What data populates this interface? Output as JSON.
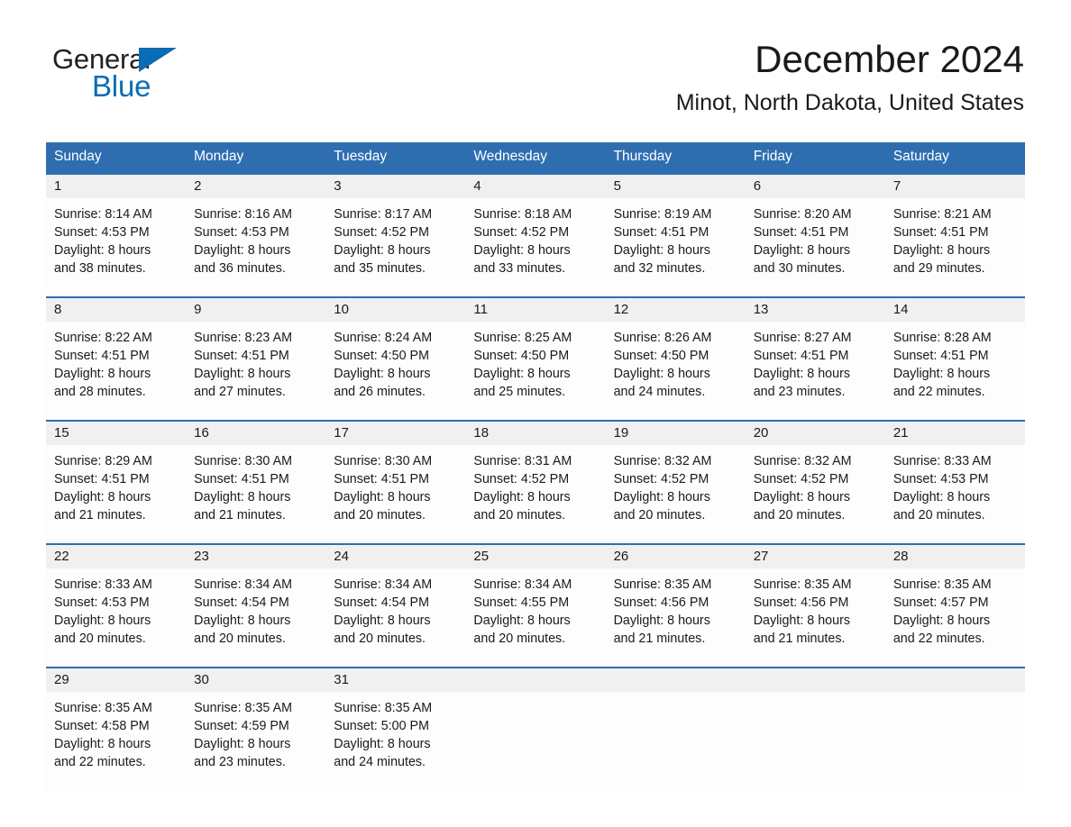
{
  "brand": {
    "name_part1": "General",
    "name_part2": "Blue",
    "accent_color": "#0a6cb4"
  },
  "header": {
    "title": "December 2024",
    "location": "Minot, North Dakota, United States"
  },
  "theme": {
    "header_blue": "#2e6eb0",
    "daynum_bg": "#f0f0f0",
    "cell_bg": "#fdfdfd",
    "text": "#1a1a1a"
  },
  "weekdays": [
    "Sunday",
    "Monday",
    "Tuesday",
    "Wednesday",
    "Thursday",
    "Friday",
    "Saturday"
  ],
  "weeks": [
    {
      "days": [
        {
          "num": "1",
          "sunrise": "Sunrise: 8:14 AM",
          "sunset": "Sunset: 4:53 PM",
          "daylight_1": "Daylight: 8 hours",
          "daylight_2": "and 38 minutes."
        },
        {
          "num": "2",
          "sunrise": "Sunrise: 8:16 AM",
          "sunset": "Sunset: 4:53 PM",
          "daylight_1": "Daylight: 8 hours",
          "daylight_2": "and 36 minutes."
        },
        {
          "num": "3",
          "sunrise": "Sunrise: 8:17 AM",
          "sunset": "Sunset: 4:52 PM",
          "daylight_1": "Daylight: 8 hours",
          "daylight_2": "and 35 minutes."
        },
        {
          "num": "4",
          "sunrise": "Sunrise: 8:18 AM",
          "sunset": "Sunset: 4:52 PM",
          "daylight_1": "Daylight: 8 hours",
          "daylight_2": "and 33 minutes."
        },
        {
          "num": "5",
          "sunrise": "Sunrise: 8:19 AM",
          "sunset": "Sunset: 4:51 PM",
          "daylight_1": "Daylight: 8 hours",
          "daylight_2": "and 32 minutes."
        },
        {
          "num": "6",
          "sunrise": "Sunrise: 8:20 AM",
          "sunset": "Sunset: 4:51 PM",
          "daylight_1": "Daylight: 8 hours",
          "daylight_2": "and 30 minutes."
        },
        {
          "num": "7",
          "sunrise": "Sunrise: 8:21 AM",
          "sunset": "Sunset: 4:51 PM",
          "daylight_1": "Daylight: 8 hours",
          "daylight_2": "and 29 minutes."
        }
      ]
    },
    {
      "days": [
        {
          "num": "8",
          "sunrise": "Sunrise: 8:22 AM",
          "sunset": "Sunset: 4:51 PM",
          "daylight_1": "Daylight: 8 hours",
          "daylight_2": "and 28 minutes."
        },
        {
          "num": "9",
          "sunrise": "Sunrise: 8:23 AM",
          "sunset": "Sunset: 4:51 PM",
          "daylight_1": "Daylight: 8 hours",
          "daylight_2": "and 27 minutes."
        },
        {
          "num": "10",
          "sunrise": "Sunrise: 8:24 AM",
          "sunset": "Sunset: 4:50 PM",
          "daylight_1": "Daylight: 8 hours",
          "daylight_2": "and 26 minutes."
        },
        {
          "num": "11",
          "sunrise": "Sunrise: 8:25 AM",
          "sunset": "Sunset: 4:50 PM",
          "daylight_1": "Daylight: 8 hours",
          "daylight_2": "and 25 minutes."
        },
        {
          "num": "12",
          "sunrise": "Sunrise: 8:26 AM",
          "sunset": "Sunset: 4:50 PM",
          "daylight_1": "Daylight: 8 hours",
          "daylight_2": "and 24 minutes."
        },
        {
          "num": "13",
          "sunrise": "Sunrise: 8:27 AM",
          "sunset": "Sunset: 4:51 PM",
          "daylight_1": "Daylight: 8 hours",
          "daylight_2": "and 23 minutes."
        },
        {
          "num": "14",
          "sunrise": "Sunrise: 8:28 AM",
          "sunset": "Sunset: 4:51 PM",
          "daylight_1": "Daylight: 8 hours",
          "daylight_2": "and 22 minutes."
        }
      ]
    },
    {
      "days": [
        {
          "num": "15",
          "sunrise": "Sunrise: 8:29 AM",
          "sunset": "Sunset: 4:51 PM",
          "daylight_1": "Daylight: 8 hours",
          "daylight_2": "and 21 minutes."
        },
        {
          "num": "16",
          "sunrise": "Sunrise: 8:30 AM",
          "sunset": "Sunset: 4:51 PM",
          "daylight_1": "Daylight: 8 hours",
          "daylight_2": "and 21 minutes."
        },
        {
          "num": "17",
          "sunrise": "Sunrise: 8:30 AM",
          "sunset": "Sunset: 4:51 PM",
          "daylight_1": "Daylight: 8 hours",
          "daylight_2": "and 20 minutes."
        },
        {
          "num": "18",
          "sunrise": "Sunrise: 8:31 AM",
          "sunset": "Sunset: 4:52 PM",
          "daylight_1": "Daylight: 8 hours",
          "daylight_2": "and 20 minutes."
        },
        {
          "num": "19",
          "sunrise": "Sunrise: 8:32 AM",
          "sunset": "Sunset: 4:52 PM",
          "daylight_1": "Daylight: 8 hours",
          "daylight_2": "and 20 minutes."
        },
        {
          "num": "20",
          "sunrise": "Sunrise: 8:32 AM",
          "sunset": "Sunset: 4:52 PM",
          "daylight_1": "Daylight: 8 hours",
          "daylight_2": "and 20 minutes."
        },
        {
          "num": "21",
          "sunrise": "Sunrise: 8:33 AM",
          "sunset": "Sunset: 4:53 PM",
          "daylight_1": "Daylight: 8 hours",
          "daylight_2": "and 20 minutes."
        }
      ]
    },
    {
      "days": [
        {
          "num": "22",
          "sunrise": "Sunrise: 8:33 AM",
          "sunset": "Sunset: 4:53 PM",
          "daylight_1": "Daylight: 8 hours",
          "daylight_2": "and 20 minutes."
        },
        {
          "num": "23",
          "sunrise": "Sunrise: 8:34 AM",
          "sunset": "Sunset: 4:54 PM",
          "daylight_1": "Daylight: 8 hours",
          "daylight_2": "and 20 minutes."
        },
        {
          "num": "24",
          "sunrise": "Sunrise: 8:34 AM",
          "sunset": "Sunset: 4:54 PM",
          "daylight_1": "Daylight: 8 hours",
          "daylight_2": "and 20 minutes."
        },
        {
          "num": "25",
          "sunrise": "Sunrise: 8:34 AM",
          "sunset": "Sunset: 4:55 PM",
          "daylight_1": "Daylight: 8 hours",
          "daylight_2": "and 20 minutes."
        },
        {
          "num": "26",
          "sunrise": "Sunrise: 8:35 AM",
          "sunset": "Sunset: 4:56 PM",
          "daylight_1": "Daylight: 8 hours",
          "daylight_2": "and 21 minutes."
        },
        {
          "num": "27",
          "sunrise": "Sunrise: 8:35 AM",
          "sunset": "Sunset: 4:56 PM",
          "daylight_1": "Daylight: 8 hours",
          "daylight_2": "and 21 minutes."
        },
        {
          "num": "28",
          "sunrise": "Sunrise: 8:35 AM",
          "sunset": "Sunset: 4:57 PM",
          "daylight_1": "Daylight: 8 hours",
          "daylight_2": "and 22 minutes."
        }
      ]
    },
    {
      "days": [
        {
          "num": "29",
          "sunrise": "Sunrise: 8:35 AM",
          "sunset": "Sunset: 4:58 PM",
          "daylight_1": "Daylight: 8 hours",
          "daylight_2": "and 22 minutes."
        },
        {
          "num": "30",
          "sunrise": "Sunrise: 8:35 AM",
          "sunset": "Sunset: 4:59 PM",
          "daylight_1": "Daylight: 8 hours",
          "daylight_2": "and 23 minutes."
        },
        {
          "num": "31",
          "sunrise": "Sunrise: 8:35 AM",
          "sunset": "Sunset: 5:00 PM",
          "daylight_1": "Daylight: 8 hours",
          "daylight_2": "and 24 minutes."
        },
        {
          "num": "",
          "sunrise": "",
          "sunset": "",
          "daylight_1": "",
          "daylight_2": ""
        },
        {
          "num": "",
          "sunrise": "",
          "sunset": "",
          "daylight_1": "",
          "daylight_2": ""
        },
        {
          "num": "",
          "sunrise": "",
          "sunset": "",
          "daylight_1": "",
          "daylight_2": ""
        },
        {
          "num": "",
          "sunrise": "",
          "sunset": "",
          "daylight_1": "",
          "daylight_2": ""
        }
      ]
    }
  ]
}
